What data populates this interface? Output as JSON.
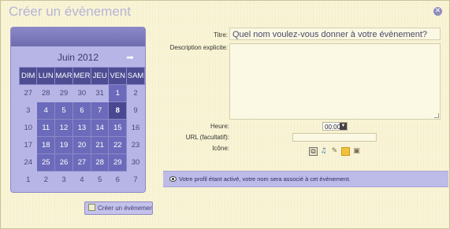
{
  "dialog": {
    "title": "Créer un évènement",
    "close_icon": "close-icon"
  },
  "calendar": {
    "month_label": "Juin 2012",
    "next_icon": "arrow-right-icon",
    "weekdays": [
      "DIM",
      "LUN",
      "MAR",
      "MER",
      "JEU",
      "VEN",
      "SAM"
    ],
    "weeks": [
      [
        "27",
        "28",
        "29",
        "30",
        "31",
        "1",
        "2"
      ],
      [
        "3",
        "4",
        "5",
        "6",
        "7",
        "8",
        "9"
      ],
      [
        "10",
        "11",
        "12",
        "13",
        "14",
        "15",
        "16"
      ],
      [
        "17",
        "18",
        "19",
        "20",
        "21",
        "22",
        "23"
      ],
      [
        "24",
        "25",
        "26",
        "27",
        "28",
        "29",
        "30"
      ],
      [
        "1",
        "2",
        "3",
        "4",
        "5",
        "6",
        "7"
      ]
    ],
    "selected_day": "8"
  },
  "create_button": {
    "label": "Créer un évènement",
    "icon": "calendar-add-icon"
  },
  "form": {
    "title_label": "Titre:",
    "title_value": "Quel nom voulez-vous donner à votre évènement?",
    "description_label": "Description explicite:",
    "hour_label": "Heure:",
    "hour_value": "00:00",
    "url_label": "URL (facultatif):",
    "icon_label": "Icône:",
    "icon_options": [
      "selection-icon",
      "music-note-icon",
      "broom-icon",
      "sticky-note-icon",
      "lock-icon"
    ]
  },
  "notice": {
    "text": "Votre profil étant activé, votre nom sera associé à cet évènement.",
    "icon": "eye-icon"
  },
  "colors": {
    "background": "#f8f3d2",
    "accent": "#6c6aba",
    "accent_dark": "#4e4c92",
    "title": "#b6b4d8"
  }
}
